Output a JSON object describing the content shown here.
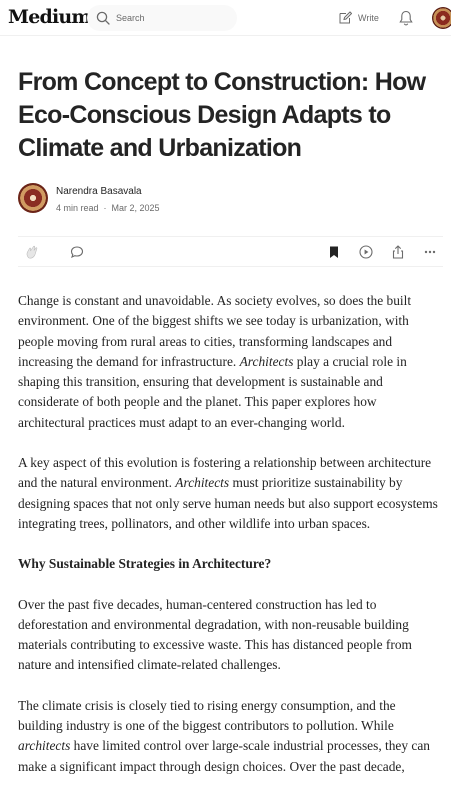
{
  "header": {
    "logo": "Medium",
    "search_placeholder": "Search",
    "write_label": "Write"
  },
  "article": {
    "title": "From Concept to Construction: How Eco-Conscious Design Adapts to Climate and Urbanization",
    "author": "Narendra Basavala",
    "read_time": "4 min read",
    "date": "Mar 2, 2025",
    "paragraphs": [
      {
        "p1a": "Change is constant and unavoidable. As society evolves, so does the built environment. One of the biggest shifts we see today is urbanization, with people moving from rural areas to cities, transforming landscapes and increasing the demand for infrastructure. ",
        "p1em": "Architects",
        "p1b": " play a crucial role in shaping this transition, ensuring that development is sustainable and considerate of both people and the planet. This paper explores how architectural practices must adapt to an ever-changing world."
      },
      {
        "p2a": "A key aspect of this evolution is fostering a relationship between architecture and the natural environment. ",
        "p2em": "Architects",
        "p2b": " must prioritize sustainability by designing spaces that not only serve human needs but also support ecosystems integrating trees, pollinators, and other wildlife into urban spaces."
      }
    ],
    "heading1": "Why Sustainable Strategies in Architecture?",
    "p3": "Over the past five decades, human-centered construction has led to deforestation and environmental degradation, with non-reusable building materials contributing to excessive waste. This has distanced people from nature and intensified climate-related challenges.",
    "p4a": "The climate crisis is closely tied to rising energy consumption, and the building industry is one of the biggest contributors to pollution. While ",
    "p4em": "architects",
    "p4b": " have limited control over large-scale industrial processes, they can make a significant impact through design choices. Over the past decade,"
  }
}
